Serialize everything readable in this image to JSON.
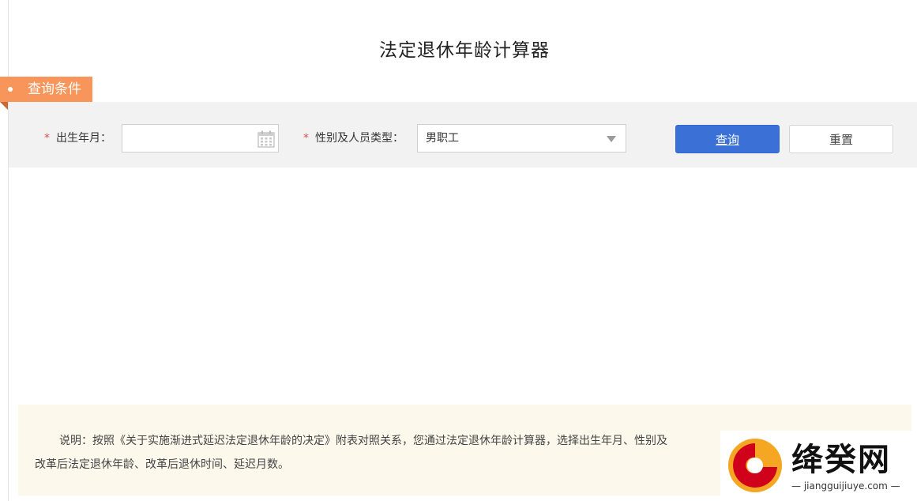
{
  "page": {
    "title": "法定退休年龄计算器"
  },
  "section": {
    "label": "查询条件"
  },
  "form": {
    "required_mark": "*",
    "birth_label": "出生年月：",
    "birth_value": "",
    "type_label": "性别及人员类型：",
    "type_selected": "男职工"
  },
  "buttons": {
    "query": "查询",
    "reset": "重置"
  },
  "note": {
    "line1": "说明：按照《关于实施渐进式延迟法定退休年龄的决定》附表对照关系，您通过法定退休年龄计算器，选择出生年月、性别及",
    "line2": "改革后法定退休年龄、改革后退休时间、延迟月数。"
  },
  "watermark": {
    "name": "绛癸网",
    "url": "jiangguijiuye.com"
  },
  "colors": {
    "accent_orange": "#f7955a",
    "primary_blue": "#3b71d6",
    "required_red": "#d9534f",
    "note_bg": "#fdf8ec"
  },
  "icons": {
    "date": "calendar-icon",
    "select": "caret-down-icon",
    "bullet": "dot-icon"
  }
}
